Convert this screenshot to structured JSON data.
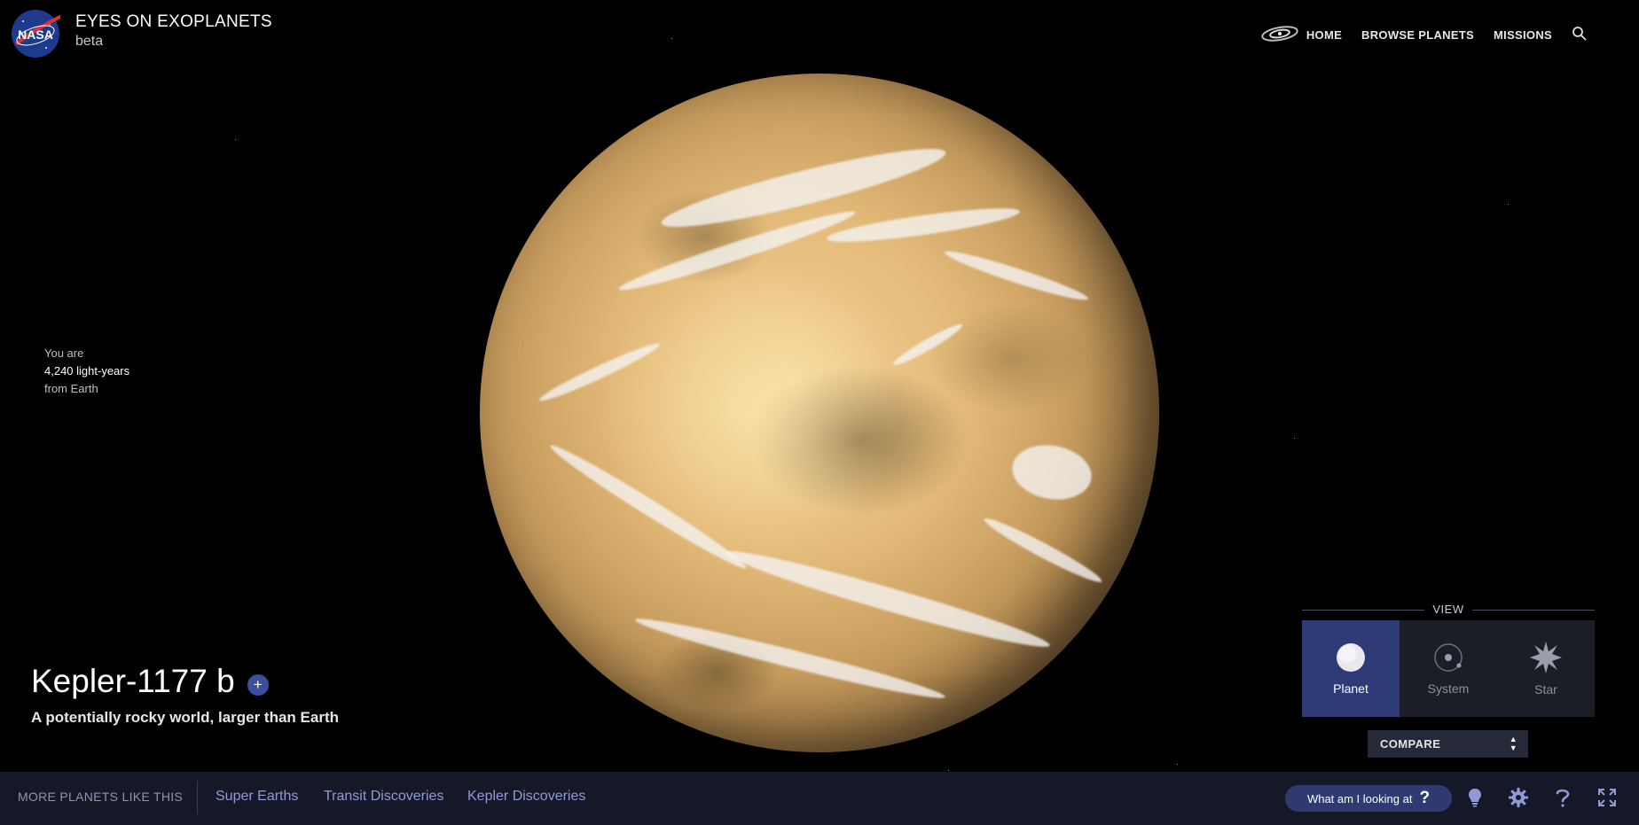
{
  "header": {
    "logo_text": "NASA",
    "title": "EYES ON EXOPLANETS",
    "subtitle": "beta",
    "nav": {
      "home": "HOME",
      "browse": "BROWSE PLANETS",
      "missions": "MISSIONS",
      "search_icon": "search-icon"
    }
  },
  "distance": {
    "prefix": "You are",
    "value": "4,240 light-years",
    "suffix": "from Earth"
  },
  "planet": {
    "name": "Kepler-1177 b",
    "add_label": "+",
    "tagline": "A potentially rocky world, larger than Earth"
  },
  "view": {
    "label": "VIEW",
    "options": [
      {
        "label": "Planet",
        "icon": "planet-icon",
        "active": true
      },
      {
        "label": "System",
        "icon": "system-icon",
        "active": false
      },
      {
        "label": "Star",
        "icon": "star-icon",
        "active": false
      }
    ],
    "compare_label": "COMPARE"
  },
  "bottom": {
    "more_title": "MORE PLANETS LIKE THIS",
    "categories": [
      "Super Earths",
      "Transit Discoveries",
      "Kepler Discoveries"
    ],
    "help_button": "What am I looking at",
    "help_mark": "?",
    "icons": [
      "lightbulb-icon",
      "gear-icon",
      "help-icon",
      "fullscreen-icon"
    ]
  },
  "colors": {
    "background": "#000000",
    "bottom_bar": "#151927",
    "accent": "#2e3b76",
    "link": "#8f9bd6",
    "planet": "#e2b877"
  }
}
